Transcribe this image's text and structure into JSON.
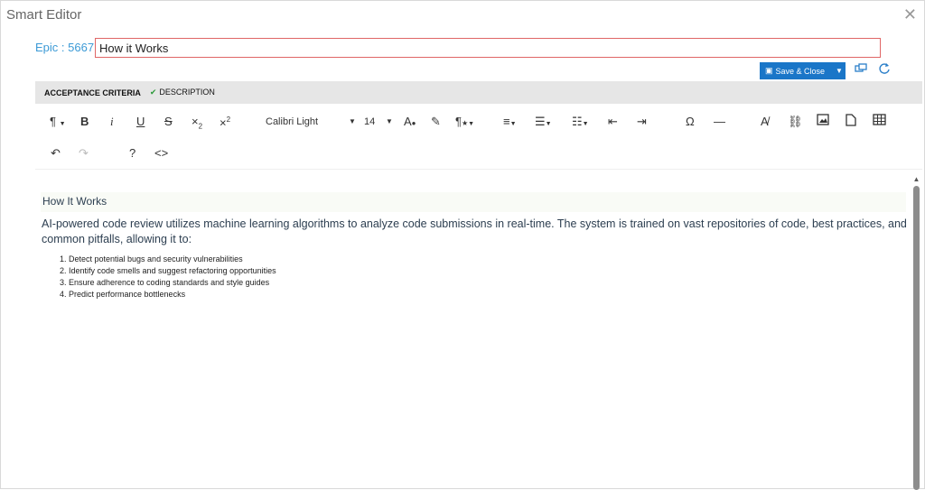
{
  "window": {
    "title": "Smart Editor"
  },
  "header": {
    "epic_label": "Epic : 5667",
    "title_value": "How it Works",
    "save_label": "Save & Close"
  },
  "tabs": [
    {
      "label": "ACCEPTANCE CRITERIA",
      "active": true
    },
    {
      "label": "DESCRIPTION",
      "checked": true
    }
  ],
  "toolbar": {
    "font_family": "Calibri Light",
    "font_size": "14",
    "icons_row1": [
      "paragraph-format",
      "bold",
      "italic",
      "underline",
      "strikethrough",
      "subscript",
      "superscript",
      "font-family",
      "font-size",
      "text-color",
      "highlight",
      "paragraph-style",
      "align",
      "ordered-list",
      "unordered-list",
      "outdent",
      "indent",
      "special-characters",
      "horizontal-line",
      "clear-formatting",
      "link",
      "image",
      "file",
      "table"
    ],
    "icons_row2": [
      "undo",
      "redo",
      "help",
      "code-view"
    ]
  },
  "content": {
    "heading": "How It Works",
    "paragraph": "AI-powered code review utilizes machine learning algorithms to analyze code submissions in real-time. The system is trained on vast repositories of code, best practices, and common pitfalls, allowing it to:",
    "list": [
      "Detect potential bugs and security vulnerabilities",
      "Identify code smells and suggest refactoring opportunities",
      "Ensure adherence to coding standards and style guides",
      "Predict performance bottlenecks"
    ]
  }
}
